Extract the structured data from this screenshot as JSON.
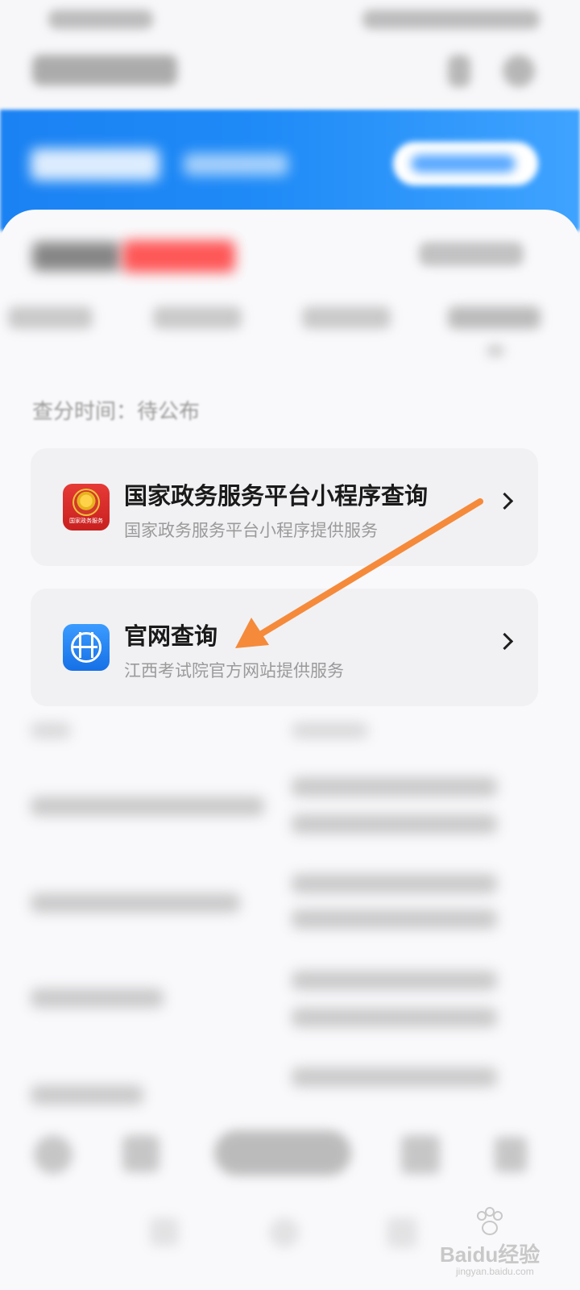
{
  "score_time": "查分时间：待公布",
  "options": [
    {
      "title": "国家政务服务平台小程序查询",
      "subtitle": "国家政务服务平台小程序提供服务",
      "icon": "national-emblem-icon",
      "icon_caption": "国家政务服务",
      "icon_color": "#d62b27"
    },
    {
      "title": "官网查询",
      "subtitle": "江西考试院官方网站提供服务",
      "icon": "globe-icon",
      "icon_color": "#2a86f5"
    }
  ],
  "annotation": {
    "type": "arrow",
    "color": "#f58a3a"
  },
  "watermark": {
    "brand": "Baidu经验",
    "url": "jingyan.baidu.com"
  },
  "colors": {
    "banner": "#1f8bf7",
    "highlight_red": "#ff3b3b"
  }
}
